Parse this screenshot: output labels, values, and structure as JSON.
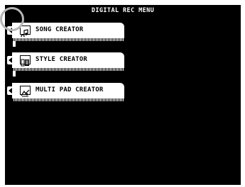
{
  "title": "DIGITAL REC MENU",
  "menu_items": [
    {
      "label": "SONG CREATOR",
      "icon": "song-creator-icon"
    },
    {
      "label": "STYLE CREATOR",
      "icon": "style-creator-icon"
    },
    {
      "label": "MULTI PAD CREATOR",
      "icon": "multi-pad-creator-icon"
    }
  ],
  "colors": {
    "screen": "#000000",
    "panel": "#ffffff",
    "highlight": "#b5b5b5"
  }
}
